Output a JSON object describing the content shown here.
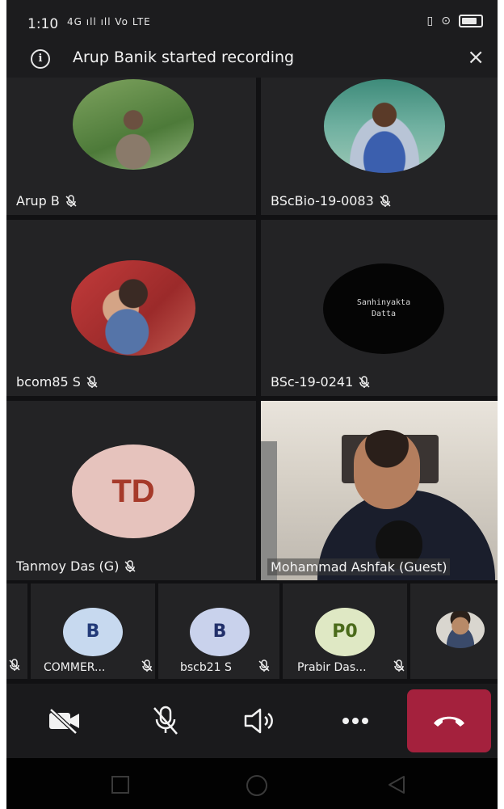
{
  "status_bar": {
    "time": "1:10",
    "network": "4G ıll ıll Vo LTE"
  },
  "banner": {
    "text": "Arup Banik started recording"
  },
  "participants": [
    {
      "name": "Arup B"
    },
    {
      "name": "BScBio-19-0083"
    },
    {
      "name": "bcom85 S"
    },
    {
      "name": "BSc-19-0241",
      "avatar_text": "Sanhinyakta Datta"
    },
    {
      "name": "Tanmoy Das (G)",
      "initials": "TD"
    },
    {
      "name": "Mohammad Ashfak (Guest)"
    }
  ],
  "strip": [
    {
      "name": "COMMER...",
      "initials": "B"
    },
    {
      "name": "bscb21 S",
      "initials": "B"
    },
    {
      "name": "Prabir Das...",
      "initials": "P0"
    }
  ],
  "colors": {
    "hangup": "#a4213d",
    "td_avatar": "#e6c3bd",
    "td_text": "#a63a2a"
  }
}
